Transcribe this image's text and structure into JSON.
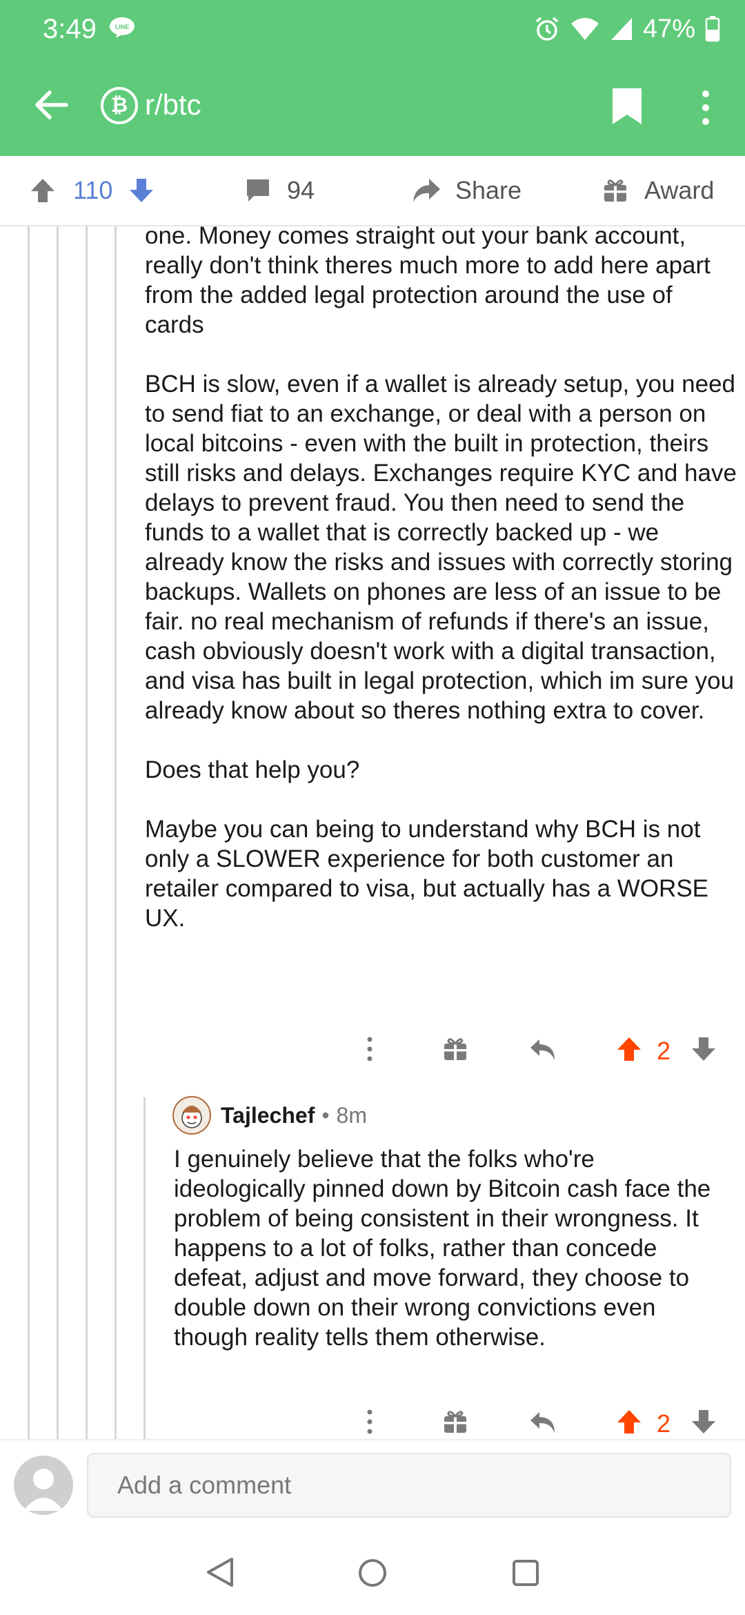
{
  "status_bar": {
    "time": "3:49",
    "line_badge": "LINE",
    "battery": "47%"
  },
  "header": {
    "subreddit": "r/btc",
    "subreddit_icon": "bitcoin-icon"
  },
  "action_bar": {
    "upvotes": "110",
    "comments": "94",
    "share_label": "Share",
    "award_label": "Award"
  },
  "comment1": {
    "paragraphs": [
      "one. Money comes straight out your bank account, really don't think theres much more to add here apart from the added legal protection around the use of cards",
      "BCH is slow, even if a wallet is already setup, you need to send fiat to an exchange, or deal with a person on local bitcoins - even with the built in protection, theirs still risks and delays. Exchanges require KYC and have delays to prevent fraud. You then need to send the funds to a wallet that is correctly backed up - we already know the risks and issues with correctly storing backups. Wallets on phones are less of an issue to be fair. no real mechanism of refunds if there's an issue, cash obviously doesn't work with a digital transaction, and visa has built in legal protection, which im sure you already know about so theres nothing extra to cover.",
      "Does that help you?",
      "Maybe you can being to understand why BCH is not only a SLOWER experience for both customer an retailer compared to visa, but actually has a WORSE UX."
    ],
    "score": "2"
  },
  "comment2": {
    "author": "Tajlechef",
    "separator": "•",
    "time": "8m",
    "text": "I genuinely believe that the folks who're ideologically pinned down by Bitcoin cash face the problem of being consistent in their wrongness. It happens to a  lot of folks, rather than concede defeat, adjust and move forward, they choose to double down on their wrong convictions even though reality tells them otherwise.",
    "score": "2"
  },
  "composer": {
    "placeholder": "Add a comment"
  },
  "colors": {
    "header": "#5fcb7a",
    "upvote_active": "#ff4500",
    "upvote_count": "#5a7fd6",
    "thread_line": "#d6d6d6"
  }
}
